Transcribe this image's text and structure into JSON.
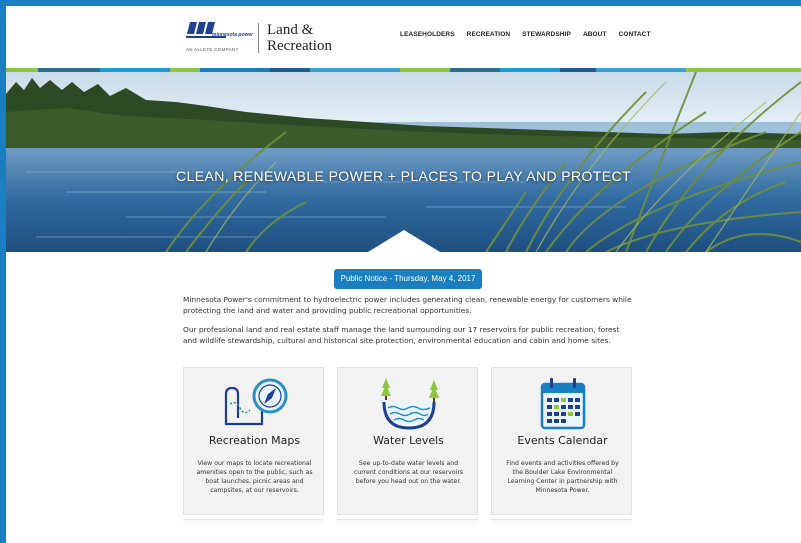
{
  "logo": {
    "brand": "minnesota power",
    "parent": "AN ALLETE COMPANY",
    "text_line1": "Land &",
    "text_line2": "Recreation"
  },
  "nav": {
    "items": [
      {
        "label": "LEASEHOLDERS"
      },
      {
        "label": "RECREATION"
      },
      {
        "label": "STEWARDSHIP"
      },
      {
        "label": "ABOUT"
      },
      {
        "label": "CONTACT"
      }
    ]
  },
  "hero": {
    "title": "CLEAN, RENEWABLE POWER + PLACES TO PLAY AND PROTECT"
  },
  "notice": {
    "label": "Public Notice - Thursday, May 4, 2017"
  },
  "intro": {
    "paragraph1": "Minnesota Power's commitment to hydroelectric power includes generating clean, renewable energy for customers while protecting the land and water and providing public recreational opportunities.",
    "paragraph2": "Our professional land and real estate staff manage the land surrounding our 17 reservoirs for public recreation, forest and wildlife stewardship, cultural and historical site protection, environmental education and cabin and home sites."
  },
  "cards": [
    {
      "icon": "map-compass-icon",
      "title": "Recreation Maps",
      "description": "View our maps to locate recreational amenities open to the public, such as boat launches, picnic areas and campsites, at our reservoirs."
    },
    {
      "icon": "water-level-icon",
      "title": "Water Levels",
      "description": "See up-to-date water levels and current conditions at our reservoirs before you head out on the water."
    },
    {
      "icon": "calendar-icon",
      "title": "Events Calendar",
      "description": "Find events and activities offered by the Boulder Lake Environmental Learning Center in partnership with Minnesota Power."
    }
  ],
  "colors": {
    "brand_blue": "#1a7fc1",
    "navy": "#1f3f8f",
    "teal": "#2a6f8f",
    "green": "#8dc63f"
  }
}
